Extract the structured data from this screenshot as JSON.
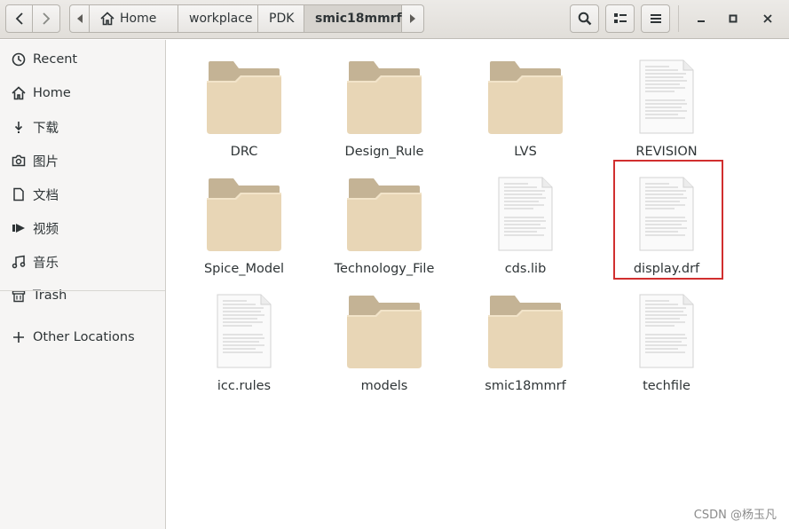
{
  "header": {
    "breadcrumbs": [
      {
        "label": "Home",
        "icon": "home-icon"
      },
      {
        "label": "workplace"
      },
      {
        "label": "PDK"
      },
      {
        "label": "smic18mmrf",
        "active": true
      }
    ]
  },
  "sidebar": {
    "items": [
      {
        "label": "Recent",
        "icon": "clock-icon"
      },
      {
        "label": "Home",
        "icon": "home-icon"
      },
      {
        "label": "下载",
        "icon": "download-icon"
      },
      {
        "label": "图片",
        "icon": "camera-icon"
      },
      {
        "label": "文档",
        "icon": "document-icon"
      },
      {
        "label": "视频",
        "icon": "video-icon"
      },
      {
        "label": "音乐",
        "icon": "music-icon"
      },
      {
        "label": "Trash",
        "icon": "trash-icon"
      },
      {
        "label": "Other Locations",
        "icon": "plus-icon"
      }
    ]
  },
  "files": [
    {
      "name": "DRC",
      "type": "folder"
    },
    {
      "name": "Design_Rule",
      "type": "folder"
    },
    {
      "name": "LVS",
      "type": "folder"
    },
    {
      "name": "REVISION",
      "type": "text-file"
    },
    {
      "name": "Spice_Model",
      "type": "folder"
    },
    {
      "name": "Technology_File",
      "type": "folder"
    },
    {
      "name": "cds.lib",
      "type": "text-file"
    },
    {
      "name": "display.drf",
      "type": "text-file",
      "highlighted": true
    },
    {
      "name": "icc.rules",
      "type": "text-file"
    },
    {
      "name": "models",
      "type": "folder"
    },
    {
      "name": "smic18mmrf",
      "type": "folder"
    },
    {
      "name": "techfile",
      "type": "text-file"
    }
  ],
  "colors": {
    "highlight": "#d12f2f",
    "folder_body": "#e8d6b6",
    "folder_tab": "#c4b395"
  },
  "watermark": "CSDN @杨玉凡"
}
